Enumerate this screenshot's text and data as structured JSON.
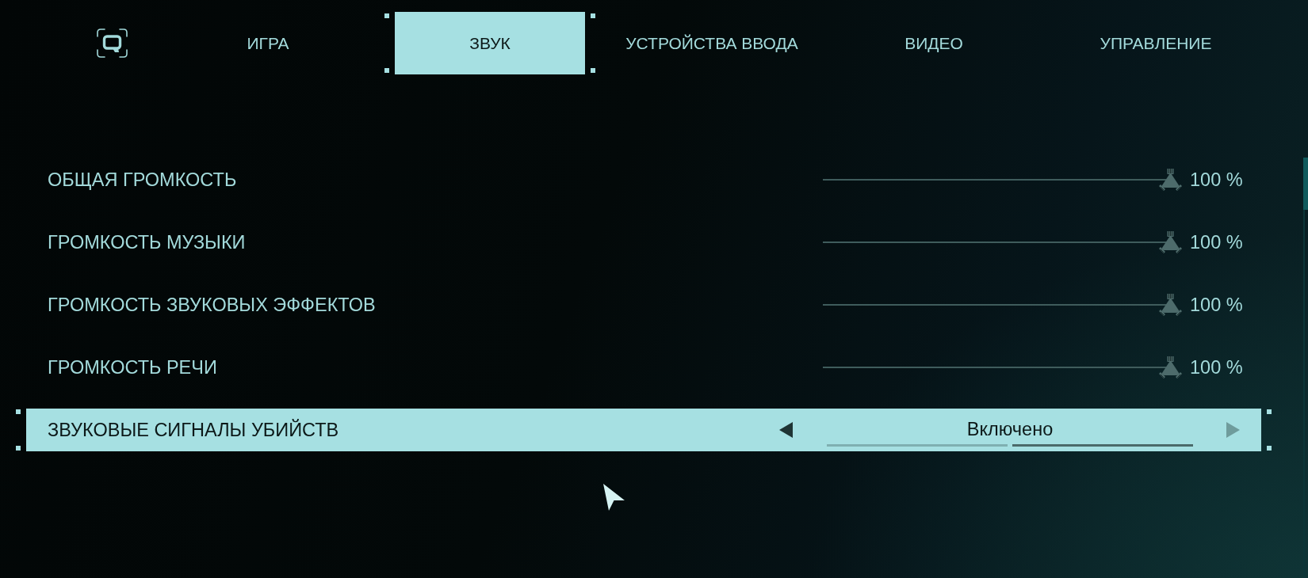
{
  "tabs": [
    {
      "label": "ИГРА",
      "selected": false
    },
    {
      "label": "ЗВУК",
      "selected": true
    },
    {
      "label": "УСТРОЙСТВА ВВОДА",
      "selected": false
    },
    {
      "label": "ВИДЕО",
      "selected": false
    },
    {
      "label": "УПРАВЛЕНИЕ",
      "selected": false
    }
  ],
  "settings": [
    {
      "kind": "slider",
      "label": "ОБЩАЯ ГРОМКОСТЬ",
      "selected": false,
      "level": 1,
      "reading": "100 %"
    },
    {
      "kind": "slider",
      "label": "ГРОМКОСТЬ МУЗЫКИ",
      "selected": false,
      "level": 1,
      "reading": "100 %"
    },
    {
      "kind": "slider",
      "label": "ГРОМКОСТЬ ЗВУКОВЫХ ЭФФЕКТОВ",
      "selected": false,
      "level": 1,
      "reading": "100 %"
    },
    {
      "kind": "slider",
      "label": "ГРОМКОСТЬ РЕЧИ",
      "selected": false,
      "level": 1,
      "reading": "100 %"
    },
    {
      "kind": "selector",
      "label": "ЗВУКОВЫЕ СИГНАЛЫ УБИЙСТВ",
      "selected": true,
      "value": "Включено",
      "previous_disabled": false,
      "next_disabled": true,
      "options": [
        {
          "selected": false
        },
        {
          "selected": true
        }
      ]
    }
  ]
}
